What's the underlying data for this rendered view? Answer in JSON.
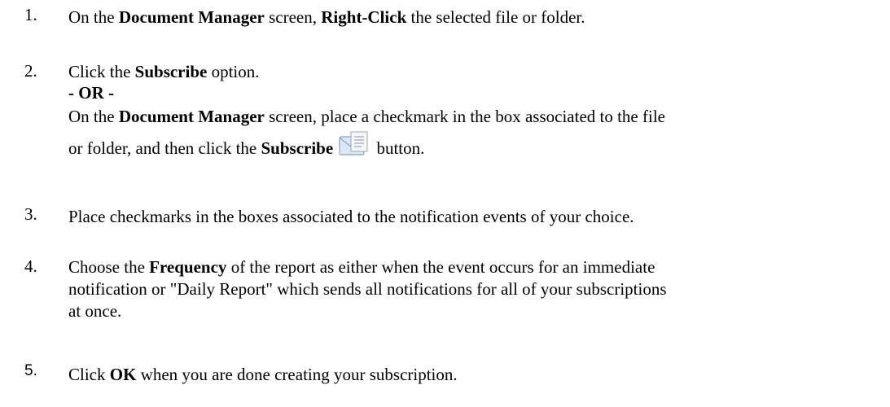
{
  "steps": [
    {
      "number": "1.",
      "parts": [
        "On the ",
        "Document Manager",
        " screen, ",
        "Right-Click",
        " the selected file or folder."
      ]
    },
    {
      "number": "2.",
      "line1": [
        "Click the ",
        "Subscribe",
        " option."
      ],
      "or_label": "- OR -",
      "line3": [
        "On the ",
        "Document Manager",
        " screen, place a checkmark in the box associated to the file"
      ],
      "line4": [
        "or folder, and then click the ",
        "Subscribe",
        " button."
      ],
      "icon": "subscribe-icon"
    },
    {
      "number": "3.",
      "text": "Place checkmarks in the boxes associated to the notification events of your choice."
    },
    {
      "number": "4.",
      "parts": [
        "Choose the ",
        "Frequency",
        " of the report as either when the event occurs for an immediate"
      ],
      "line2": "notification or \"Daily Report\" which sends all notifications for all of your subscriptions",
      "line3": "at once."
    },
    {
      "number": "5.",
      "parts": [
        "Click ",
        "OK",
        " when you are done creating your subscription."
      ]
    }
  ],
  "colors": {
    "text": "#000000",
    "icon_blue": "#6fa8d6",
    "icon_paper": "#f4f4f4"
  }
}
